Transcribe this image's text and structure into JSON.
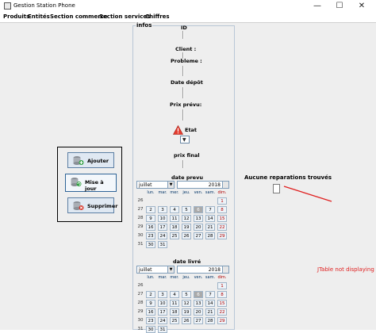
{
  "window": {
    "title": "Gestion Station Phone",
    "buttons": {
      "minimize": "—",
      "maximize": "☐",
      "close": "✕"
    }
  },
  "menu": [
    "Produits",
    "Entités",
    "Section commerce",
    "Section services",
    "Chiffres"
  ],
  "form": {
    "panel_title": "infos",
    "id_label": "ID",
    "client_label": "Client :",
    "probleme_label": "Probleme :",
    "date_depot_label": "Date dépôt",
    "prix_prevu_label": "Prix prévu:",
    "etat_label": "Etat",
    "prix_final_label": "prix final",
    "date_prevu_label": "date prevu",
    "date_livre_label": "date livré"
  },
  "calendar": {
    "month": "juillet",
    "year": "2018",
    "day_headers": [
      "lun.",
      "mar.",
      "mer.",
      "jeu.",
      "ven.",
      "sam.",
      "dim."
    ],
    "weeks": [
      "26",
      "27",
      "28",
      "29",
      "30",
      "31"
    ],
    "days": [
      [
        "",
        "",
        "",
        "",
        "",
        "",
        "1"
      ],
      [
        "2",
        "3",
        "4",
        "5",
        "6",
        "7",
        "8"
      ],
      [
        "9",
        "10",
        "11",
        "12",
        "13",
        "14",
        "15"
      ],
      [
        "16",
        "17",
        "18",
        "19",
        "20",
        "21",
        "22"
      ],
      [
        "23",
        "24",
        "25",
        "26",
        "27",
        "28",
        "29"
      ],
      [
        "30",
        "31",
        "",
        "",
        "",
        "",
        ""
      ]
    ],
    "today": "6"
  },
  "actions": {
    "add": "Ajouter",
    "update": "Mise à jour",
    "delete": "Supprimer"
  },
  "results": {
    "empty_label": "Aucune reparations trouvés"
  },
  "annotation": {
    "text": "JTable not displaying",
    "color": "#e02020"
  }
}
